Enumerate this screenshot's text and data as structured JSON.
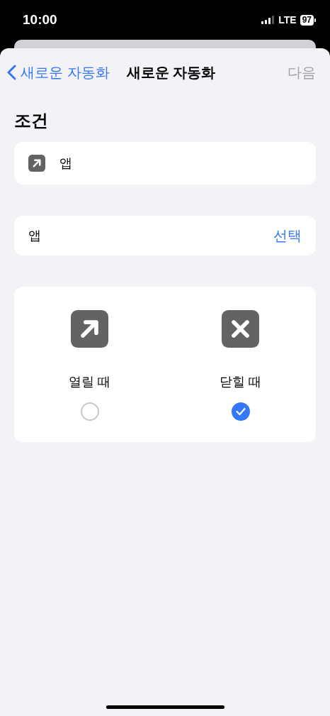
{
  "status_bar": {
    "time": "10:00",
    "network": "LTE",
    "battery": "97"
  },
  "nav_bar": {
    "back_label": "새로운 자동화",
    "title": "새로운 자동화",
    "next_label": "다음",
    "next_disabled": true
  },
  "section_title": "조건",
  "condition": {
    "label": "앱"
  },
  "app_row": {
    "label": "앱",
    "action": "선택"
  },
  "options": [
    {
      "kind": "arrow",
      "label": "열릴 때",
      "selected": false
    },
    {
      "kind": "cross",
      "label": "닫힐 때",
      "selected": true
    }
  ]
}
